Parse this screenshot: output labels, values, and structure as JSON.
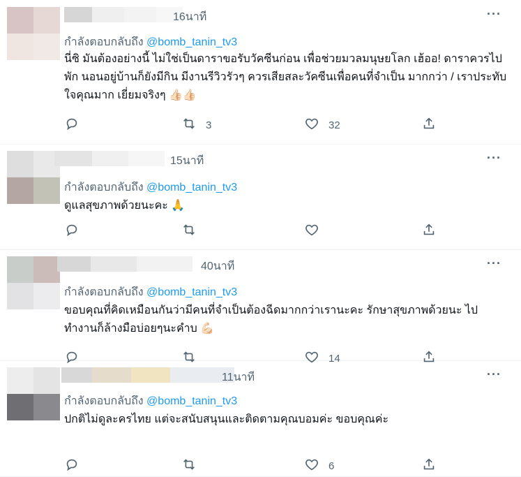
{
  "tweets": [
    {
      "time": "16นาที",
      "reply_prefix": "กำลังตอบกลับถึง",
      "reply_handle": "@bomb_tanin_tv3",
      "text": "นี่ซิ มันต้องอย่างนี้ ไม่ใช่เป็นดาราขอรับวัคซีนก่อน เพื่อช่วยมวลมนุษยโลก เฮ้ออ! ดาราควรไปพัก นอนอยู่บ้านก็ยังมีกิน มีงานรีวิวรัวๆ ควรเสียสละวัคซีนเพื่อคนที่จำเป็น มากกว่า / เราประทับใจคุณมาก เยี่ยมจริงๆ 👍🏻👍🏻",
      "retweets": "3",
      "likes": "32",
      "avatar_colors": [
        "#d8c4c4",
        "#e6d8d4",
        "#efe6e2",
        "#f0e9e6"
      ],
      "name_colors": [
        "#d6d6d6",
        "#efefef",
        "#f3f3f3",
        "#f7f7f7"
      ]
    },
    {
      "time": "15นาที",
      "reply_prefix": "กำลังตอบกลับถึง",
      "reply_handle": "@bomb_tanin_tv3",
      "text": "ดูแลสุขภาพด้วยนะคะ 🙏",
      "retweets": "",
      "likes": "",
      "avatar_colors": [
        "#dedede",
        "#e9e9e9",
        "#b4a7a3",
        "#c2c2b6"
      ],
      "name_colors": [
        "#e4e4e4",
        "#f0f0f0",
        "#f6f6f6"
      ]
    },
    {
      "time": "40นาที",
      "reply_prefix": "กำลังตอบกลับถึง",
      "reply_handle": "@bomb_tanin_tv3",
      "text": "ขอบคุณที่คิดเหมือนกันว่ามีคนที่จำเป็นต้องฉีดมากกว่าเรานะคะ รักษาสุขภาพด้วยนะ ไปทำงานก็ล้างมือบ่อยๆนะคำบ 💪🏻",
      "retweets": "",
      "likes": "14",
      "avatar_colors": [
        "#c9cdca",
        "#cbbcb9",
        "#e2e2e4",
        "#ececee"
      ],
      "name_colors": [
        "#d7d7d7",
        "#e8e8e8",
        "#f2f2f2"
      ]
    },
    {
      "time": "11นาที",
      "reply_prefix": "กำลังตอบกลับถึง",
      "reply_handle": "@bomb_tanin_tv3",
      "text": "ปกติไม่ดูละครไทย แต่จะสนับสนุนและติดตามคุณบอมค่ะ ขอบคุณค่ะ",
      "retweets": "",
      "likes": "6",
      "avatar_colors": [
        "#ededed",
        "#e4e4e4",
        "#6f6e72",
        "#8a8a8e"
      ],
      "name_colors": [
        "#d8d8d8",
        "#e6dccb",
        "#f1e4c0",
        "#e9edf2"
      ]
    }
  ],
  "icons": {
    "reply": "reply-icon",
    "retweet": "retweet-icon",
    "like": "heart-icon",
    "share": "share-icon",
    "more": "more-icon"
  }
}
